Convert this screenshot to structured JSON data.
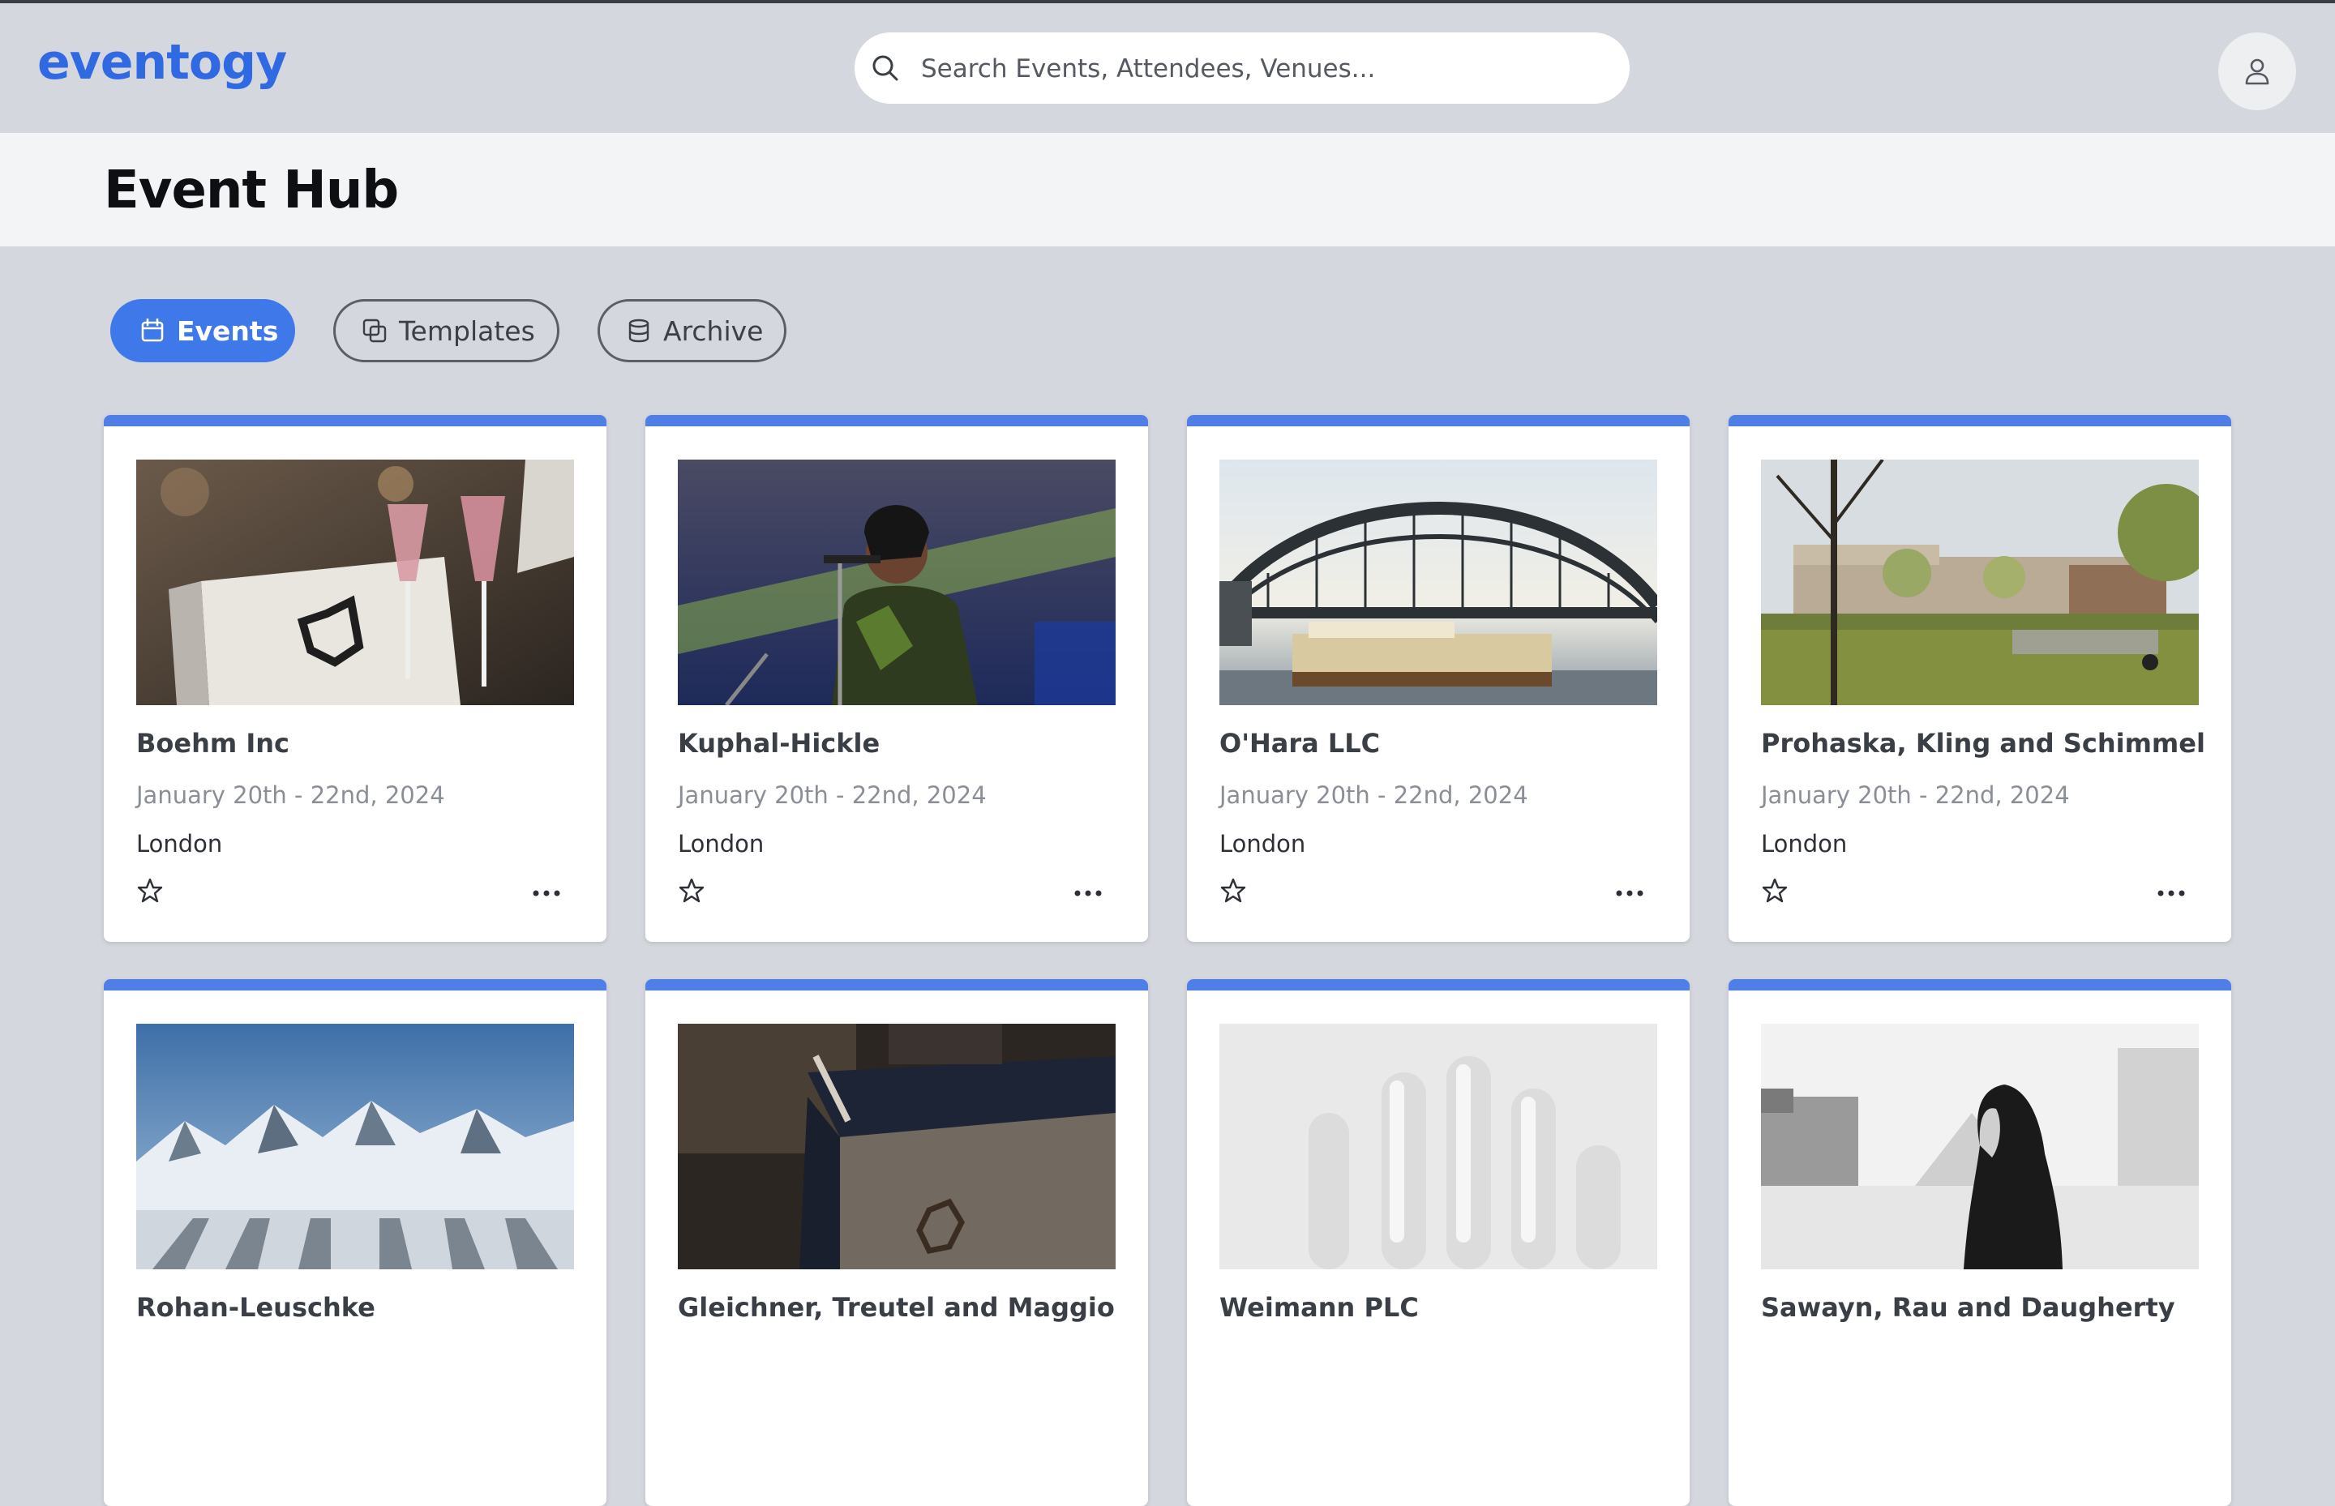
{
  "app": {
    "logo_text": "eventogy",
    "brand_color": "#2f6ae3",
    "accent_color": "#4f7fe6"
  },
  "search": {
    "placeholder": "Search Events, Attendees, Venues...",
    "value": ""
  },
  "header": {
    "avatar_icon": "user-icon"
  },
  "page": {
    "title": "Event Hub"
  },
  "tabs": [
    {
      "label": "Events",
      "icon": "calendar-icon",
      "active": true
    },
    {
      "label": "Templates",
      "icon": "copy-icon",
      "active": false
    },
    {
      "label": "Archive",
      "icon": "database-icon",
      "active": false
    }
  ],
  "events": [
    {
      "name": "Boehm Inc",
      "date": "January 20th - 22nd, 2024",
      "location": "London",
      "image": "champagne-glasses-image"
    },
    {
      "name": "Kuphal-Hickle",
      "date": "January 20th - 22nd, 2024",
      "location": "London",
      "image": "singer-concert-image"
    },
    {
      "name": "O'Hara LLC",
      "date": "January 20th - 22nd, 2024",
      "location": "London",
      "image": "harbour-bridge-image"
    },
    {
      "name": "Prohaska, Kling and Schimmel",
      "date": "January 20th - 22nd, 2024",
      "location": "London",
      "image": "park-lawn-image"
    },
    {
      "name": "Rohan-Leuschke",
      "date": "",
      "location": "",
      "image": "snowy-mountains-image"
    },
    {
      "name": "Gleichner, Treutel and Maggio",
      "date": "",
      "location": "",
      "image": "gift-box-image"
    },
    {
      "name": "Weimann PLC",
      "date": "",
      "location": "",
      "image": "cotton-swabs-image"
    },
    {
      "name": "Sawayn, Rau and Daugherty",
      "date": "",
      "location": "",
      "image": "louvre-portrait-image"
    }
  ]
}
